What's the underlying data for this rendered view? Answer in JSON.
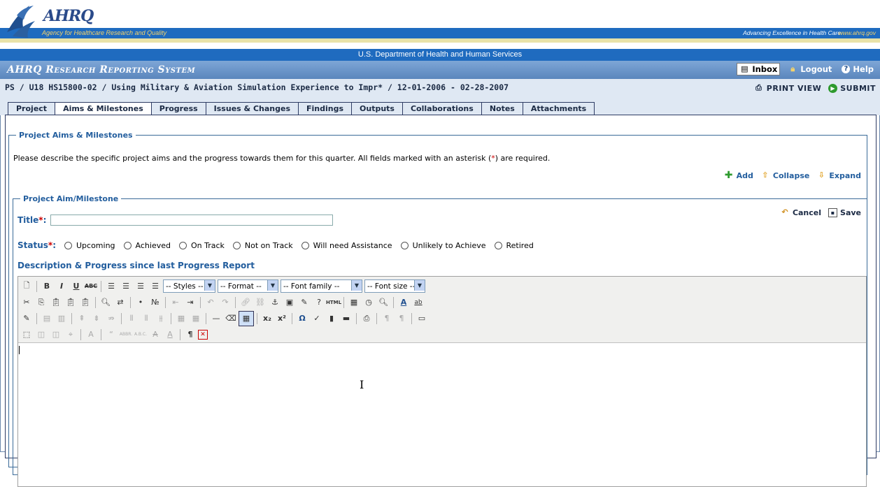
{
  "header": {
    "logo_text": "AHRQ",
    "agency": "Agency for Healthcare Research and Quality",
    "tagline": "Advancing Excellence in Health Care",
    "site": "www.ahrq.gov",
    "department": "U.S. Department of Health and Human Services"
  },
  "titlebar": {
    "system_name": "AHRQ Research Reporting System",
    "nav": {
      "inbox": "Inbox",
      "logout": "Logout",
      "help": "Help"
    }
  },
  "project": {
    "path": "PS / U18 HS15800-02 / Using Military & Aviation Simulation Experience to Impr* / 12-01-2006 - 02-28-2007",
    "print_view": "PRINT VIEW",
    "submit": "SUBMIT"
  },
  "tabs": [
    {
      "label": "Project"
    },
    {
      "label": "Aims & Milestones"
    },
    {
      "label": "Progress"
    },
    {
      "label": "Issues & Changes"
    },
    {
      "label": "Findings"
    },
    {
      "label": "Outputs"
    },
    {
      "label": "Collaborations"
    },
    {
      "label": "Notes"
    },
    {
      "label": "Attachments"
    }
  ],
  "active_tab": "Aims & Milestones",
  "aims": {
    "legend": "Project Aims & Milestones",
    "instructions_pre": "Please describe the specific project aims and the progress towards them for this quarter. All fields marked with an asterisk (",
    "asterisk": "*",
    "instructions_post": ") are required.",
    "actions": {
      "add": "Add",
      "collapse": "Collapse",
      "expand": "Expand"
    }
  },
  "milestone": {
    "legend": "Project Aim/Milestone",
    "cancel": "Cancel",
    "save": "Save",
    "title_label": "Title",
    "title_value": "",
    "status_label": "Status",
    "required_mark": "*",
    "colon": ":",
    "status_options": [
      "Upcoming",
      "Achieved",
      "On Track",
      "Not on Track",
      "Will need Assistance",
      "Unlikely to Achieve",
      "Retired"
    ],
    "description_label": "Description & Progress since last Progress Report"
  },
  "editor": {
    "styles": "-- Styles --",
    "format": "-- Format --",
    "font_family": "-- Font family --",
    "font_size": "-- Font size --",
    "content": ""
  },
  "colors": {
    "banner_blue": "#1f6bbf",
    "title_blue": "#6b95c9",
    "label_blue": "#235e9e",
    "required_red": "#cc0000"
  }
}
